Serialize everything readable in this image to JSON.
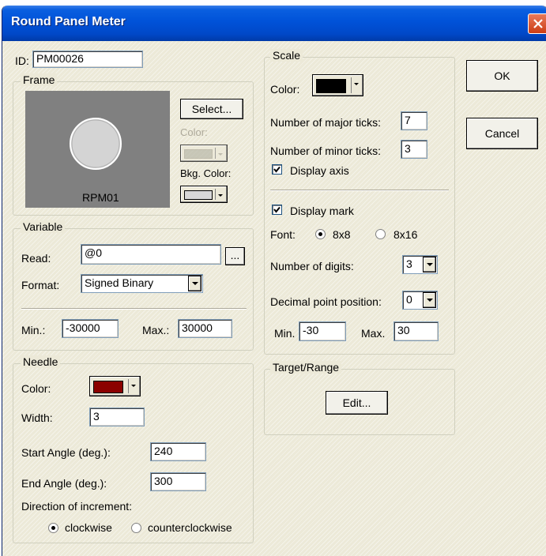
{
  "window": {
    "title": "Round Panel Meter"
  },
  "id_field": {
    "label": "ID:",
    "value": "PM00026"
  },
  "frame": {
    "group_label": "Frame",
    "preview_caption": "RPM01",
    "select_button": "Select...",
    "color_label": "Color:",
    "bkg_color_label": "Bkg. Color:",
    "color_value": "#b8b8a8",
    "bkg_color_value": "#d8d8d8"
  },
  "variable": {
    "group_label": "Variable",
    "read_label": "Read:",
    "read_value": "@0",
    "browse_button": "...",
    "format_label": "Format:",
    "format_value": "Signed Binary",
    "min_label": "Min.:",
    "min_value": "-30000",
    "max_label": "Max.:",
    "max_value": "30000"
  },
  "needle": {
    "group_label": "Needle",
    "color_label": "Color:",
    "color_value": "#8b0000",
    "width_label": "Width:",
    "width_value": "3",
    "start_angle_label": "Start Angle (deg.):",
    "start_angle_value": "240",
    "end_angle_label": "End Angle (deg.):",
    "end_angle_value": "300",
    "direction_label": "Direction of increment:",
    "clockwise_label": "clockwise",
    "counterclockwise_label": "counterclockwise",
    "direction_selected": "clockwise"
  },
  "scale": {
    "group_label": "Scale",
    "color_label": "Color:",
    "color_value": "#000000",
    "major_ticks_label": "Number of major ticks:",
    "major_ticks_value": "7",
    "minor_ticks_label": "Number of minor ticks:",
    "minor_ticks_value": "3",
    "display_axis_label": "Display axis",
    "display_axis_checked": true,
    "display_mark_label": "Display mark",
    "display_mark_checked": true,
    "font_label": "Font:",
    "font_8x8": "8x8",
    "font_8x16": "8x16",
    "font_selected": "8x8",
    "digits_label": "Number of digits:",
    "digits_value": "3",
    "decimal_label": "Decimal point position:",
    "decimal_value": "0",
    "min_label": "Min.",
    "min_value": "-30",
    "max_label": "Max.",
    "max_value": "30"
  },
  "target_range": {
    "group_label": "Target/Range",
    "edit_button": "Edit..."
  },
  "buttons": {
    "ok": "OK",
    "cancel": "Cancel"
  }
}
